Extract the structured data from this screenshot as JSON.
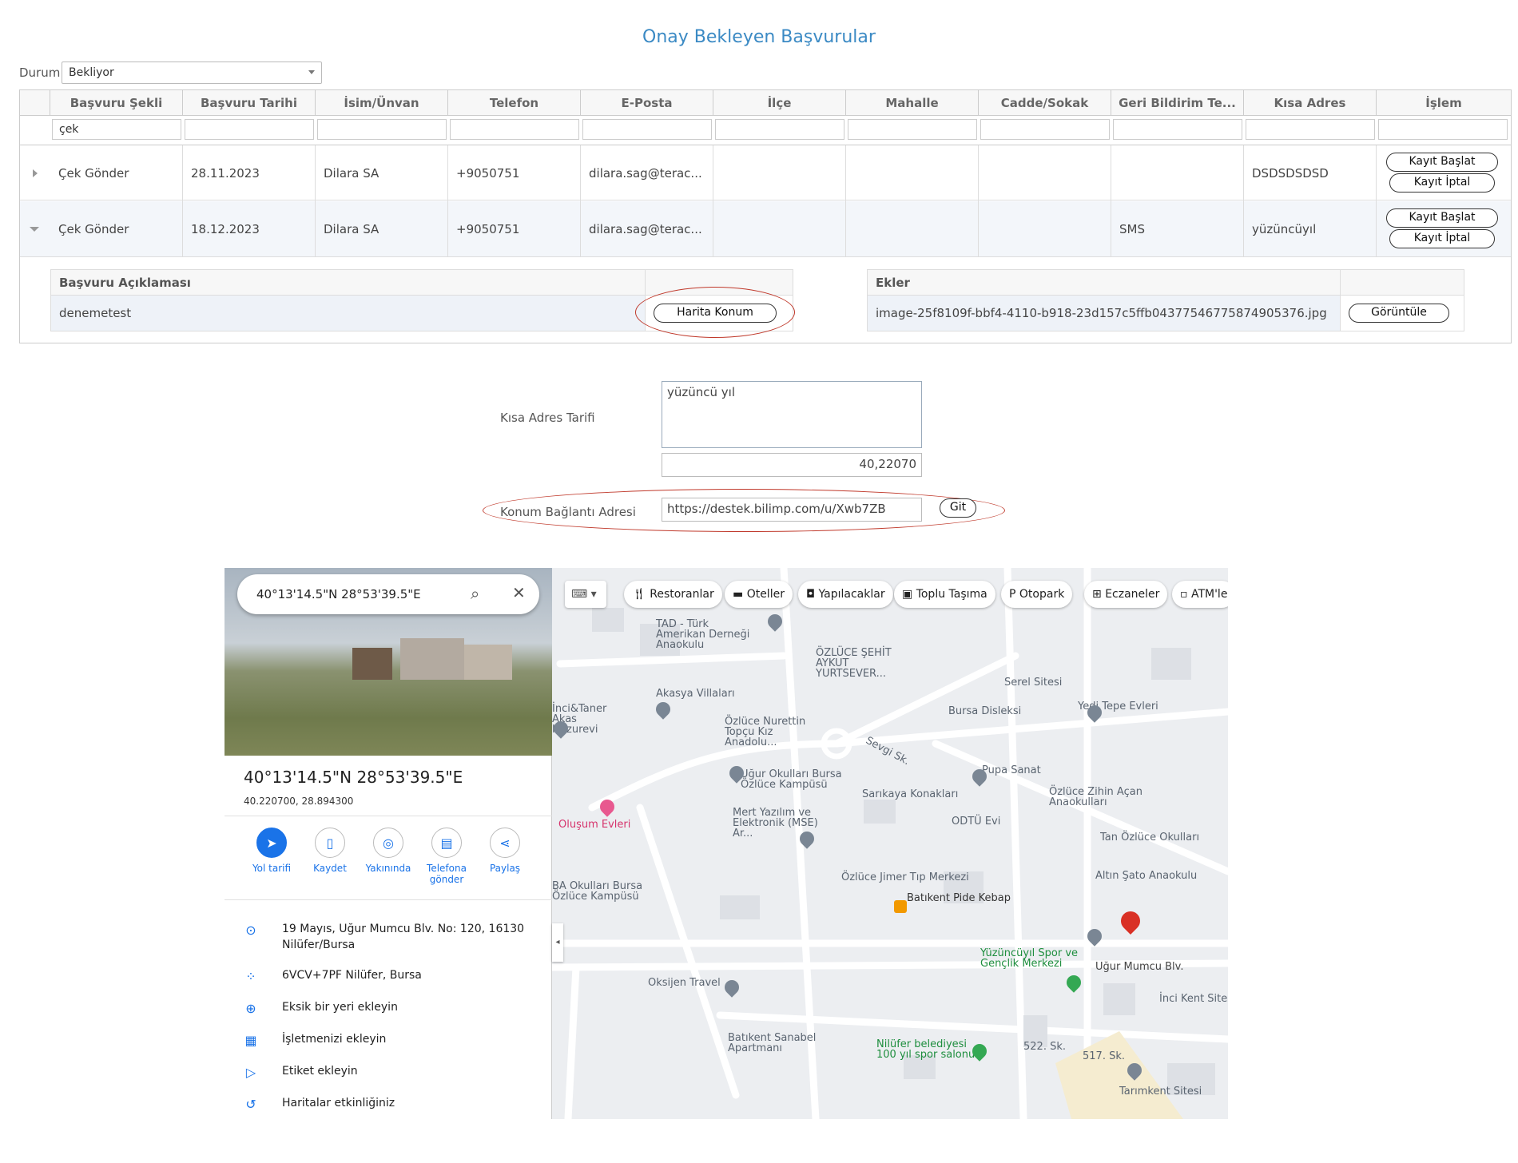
{
  "page_title": "Onay Bekleyen Başvurular",
  "filter": {
    "label": "Durum",
    "value": "Bekliyor"
  },
  "grid": {
    "columns": [
      "Başvuru Şekli",
      "Başvuru Tarihi",
      "İsim/Ünvan",
      "Telefon",
      "E-Posta",
      "İlçe",
      "Mahalle",
      "Cadde/Sokak",
      "Geri Bildirim Te...",
      "Kısa Adres",
      "İşlem"
    ],
    "filter_value": "çek",
    "rows": [
      {
        "sekil": "Çek Gönder",
        "tarih": "28.11.2023",
        "isim": "Dilara SA",
        "telefon": "+9050751",
        "eposta": "dilara.sag@terac...",
        "ilce": "",
        "mahalle": "",
        "cadde": "",
        "geri": "",
        "kisa": "DSDSDSDSD"
      },
      {
        "sekil": "Çek Gönder",
        "tarih": "18.12.2023",
        "isim": "Dilara SA",
        "telefon": "+9050751",
        "eposta": "dilara.sag@terac...",
        "ilce": "",
        "mahalle": "",
        "cadde": "",
        "geri": "SMS",
        "kisa": "yüzüncüyıl"
      }
    ],
    "actions": {
      "start": "Kayıt Başlat",
      "cancel": "Kayıt İptal"
    }
  },
  "detail": {
    "aciklama_header": "Başvuru Açıklaması",
    "aciklama_value": "denemetest",
    "map_button": "Harita Konum",
    "ekler_header": "Ekler",
    "ekler_file": "image-25f8109f-bbf4-4110-b918-23d157c5ffb04377546775874905376.jpg",
    "view_button": "Görüntüle"
  },
  "form": {
    "kisa_label": "Kısa Adres Tarifi",
    "kisa_value": "yüzüncü yıl",
    "coord_value": "40,22070",
    "konum_label": "Konum Bağlantı Adresi",
    "konum_value": "https://destek.bilimp.com/u/Xwb7ZB",
    "git_button": "Git"
  },
  "map": {
    "search_value": "40°13'14.5\"N 28°53'39.5\"E",
    "place_title": "40°13'14.5\"N 28°53'39.5\"E",
    "place_coords": "40.220700, 28.894300",
    "actions": [
      "Yol tarifi",
      "Kaydet",
      "Yakınında",
      "Telefona gönder",
      "Paylaş"
    ],
    "info": [
      {
        "icon": "location-pin-icon",
        "text": "19 Mayıs, Uğur Mumcu Blv. No: 120, 16130",
        "text2": "Nilüfer/Bursa"
      },
      {
        "icon": "plus-code-icon",
        "text": "6VCV+7PF Nilüfer, Bursa",
        "text2": ""
      },
      {
        "icon": "add-place-icon",
        "text": "Eksik bir yeri ekleyin",
        "text2": ""
      },
      {
        "icon": "add-business-icon",
        "text": "İşletmenizi ekleyin",
        "text2": ""
      },
      {
        "icon": "label-icon",
        "text": "Etiket ekleyin",
        "text2": ""
      },
      {
        "icon": "history-icon",
        "text": "Haritalar etkinliğiniz",
        "text2": ""
      }
    ],
    "chips": [
      "Restoranlar",
      "Oteller",
      "Yapılacaklar",
      "Toplu Taşıma",
      "Otopark",
      "Eczaneler",
      "ATM'le"
    ],
    "labels": {
      "l1": "TAD - Türk Amerikan Derneği Anaokulu",
      "l2": "ÖZLÜCE ŞEHİT AYKUT YURTSEVER...",
      "l3": "Akasya Villaları",
      "l4": "İnci&Taner Akas Huzurevi",
      "l5": "Özlüce Nurettin Topçu Kız Anadolu...",
      "l6": "Bursa Disleksi",
      "l7": "Serel Sitesi",
      "l8": "Yedi Tepe Evleri",
      "l9": "Uğur Okulları Bursa Özlüce Kampüsü",
      "l10": "Pupa Sanat",
      "l11": "Sarıkaya Konakları",
      "l12": "Özlüce Zihin Açan Anaokulları",
      "l13": "Oluşum Evleri",
      "l14": "Mert Yazılım ve Elektronik (MSE) Ar...",
      "l15": "ODTÜ Evi",
      "l16": "Tan Özlüce Okulları",
      "l17": "BA Okulları Bursa Özlüce Kampüsü",
      "l18": "Özlüce Jimer Tıp Merkezi",
      "l19": "Batıkent Pide Kebap",
      "l20": "Altın Şato Anaokulu",
      "l21": "Yüzüncüyıl Spor ve Gençlik Merkezi",
      "l22": "Uğur Mumcu Blv.",
      "l23": "Oksijen Travel",
      "l24": "İnci Kent Sitesi",
      "l25": "Batıkent Sanabel Apartmanı",
      "l26": "Nilüfer belediyesi 100 yıl spor salonu",
      "l27": "Tarımkent Sitesi",
      "l28": "Sevgi Sk.",
      "l29": "522. Sk.",
      "l30": "517. Sk."
    }
  }
}
